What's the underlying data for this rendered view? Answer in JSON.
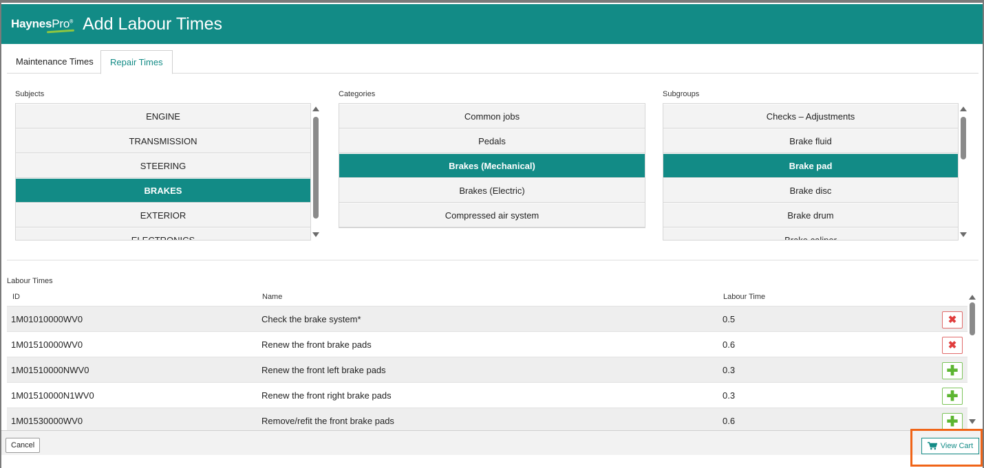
{
  "header": {
    "brand_bold": "Haynes",
    "brand_light": "Pro",
    "brand_mark": "®",
    "title": "Add Labour Times",
    "brand_color": "#128b86"
  },
  "tabs": [
    {
      "label": "Maintenance Times",
      "active": false
    },
    {
      "label": "Repair Times",
      "active": true
    }
  ],
  "subjects": {
    "label": "Subjects",
    "items": [
      "ENGINE",
      "TRANSMISSION",
      "STEERING",
      "BRAKES",
      "EXTERIOR",
      "ELECTRONICS"
    ],
    "selected": "BRAKES"
  },
  "categories": {
    "label": "Categories",
    "items": [
      "Common jobs",
      "Pedals",
      "Brakes (Mechanical)",
      "Brakes (Electric)",
      "Compressed air system"
    ],
    "selected": "Brakes (Mechanical)"
  },
  "subgroups": {
    "label": "Subgroups",
    "items": [
      "Checks – Adjustments",
      "Brake fluid",
      "Brake pad",
      "Brake disc",
      "Brake drum",
      "Brake caliper"
    ],
    "selected": "Brake pad"
  },
  "labour": {
    "label": "Labour Times",
    "columns": {
      "id": "ID",
      "name": "Name",
      "time": "Labour Time"
    },
    "rows": [
      {
        "id": "1M01010000WV0",
        "name": "Check the brake system*",
        "time": "0.5",
        "action": "remove"
      },
      {
        "id": "1M01510000WV0",
        "name": "Renew the front brake pads",
        "time": "0.6",
        "action": "remove"
      },
      {
        "id": "1M01510000NWV0",
        "name": "Renew the front left brake pads",
        "time": "0.3",
        "action": "add"
      },
      {
        "id": "1M01510000N1WV0",
        "name": "Renew the front right brake pads",
        "time": "0.3",
        "action": "add"
      },
      {
        "id": "1M01530000WV0",
        "name": "Remove/refit the front brake pads",
        "time": "0.6",
        "action": "add"
      }
    ]
  },
  "footer": {
    "cancel_label": "Cancel",
    "cart_label": "View Cart",
    "cart_icon": "cart-icon"
  },
  "colors": {
    "accent": "#128b86",
    "remove": "#e03c3c",
    "add": "#5cb531",
    "highlight": "#f06417"
  }
}
